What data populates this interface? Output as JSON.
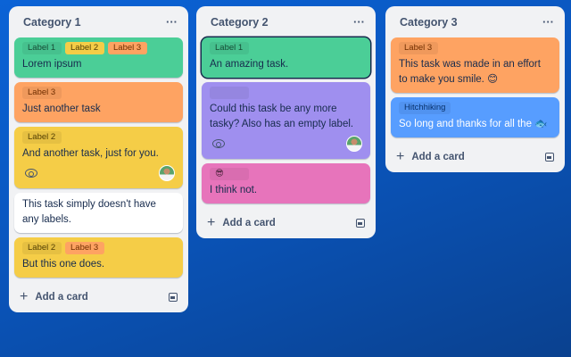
{
  "colors": {
    "green": "#4bce97",
    "orange": "#fea362",
    "yellow": "#f5cd47",
    "purple": "#9f8fef",
    "pink": "#e774bb",
    "blue": "#579dff",
    "white": "#ffffff"
  },
  "columns": [
    {
      "title": "Category 1",
      "menu": "···",
      "add_label": "Add a card",
      "cards": [
        {
          "color": "green",
          "labels": [
            {
              "text": "Label 1",
              "color": "green"
            },
            {
              "text": "Label 2",
              "color": "yellow"
            },
            {
              "text": "Label 3",
              "color": "orange"
            }
          ],
          "text": "Lorem ipsum"
        },
        {
          "color": "orange",
          "labels": [
            {
              "text": "Label 3",
              "color": "orange"
            }
          ],
          "text": "Just another task"
        },
        {
          "color": "yellow",
          "labels": [
            {
              "text": "Label 2",
              "color": "yellow"
            }
          ],
          "text": "And another task, just for you.",
          "watch": true,
          "avatar": true
        },
        {
          "color": "white",
          "labels": [],
          "text": "This task simply doesn't have any labels."
        },
        {
          "color": "yellow",
          "labels": [
            {
              "text": "Label 2",
              "color": "yellow"
            },
            {
              "text": "Label 3",
              "color": "orange"
            }
          ],
          "text": "But this one does."
        }
      ]
    },
    {
      "title": "Category 2",
      "menu": "···",
      "add_label": "Add a card",
      "cards": [
        {
          "color": "green",
          "selected": true,
          "labels": [
            {
              "text": "Label 1",
              "color": "green"
            }
          ],
          "text": "An amazing task."
        },
        {
          "color": "purple",
          "labels": [
            {
              "text": "",
              "color": "purple"
            }
          ],
          "text": "Could this task be any more tasky? Also has an empty label.",
          "watch": true,
          "avatar": true
        },
        {
          "color": "pink",
          "labels": [
            {
              "text": "😎",
              "color": "pink"
            }
          ],
          "text": "I think not."
        }
      ]
    },
    {
      "title": "Category 3",
      "menu": "···",
      "add_label": "Add a card",
      "cards": [
        {
          "color": "orange",
          "labels": [
            {
              "text": "Label 3",
              "color": "orange"
            }
          ],
          "text": "This task was made in an effort to make you smile. 😊"
        },
        {
          "color": "blue",
          "labels": [
            {
              "text": "Hitchhiking",
              "color": "blue"
            }
          ],
          "text": "So long and thanks for all the 🐟"
        }
      ]
    }
  ]
}
